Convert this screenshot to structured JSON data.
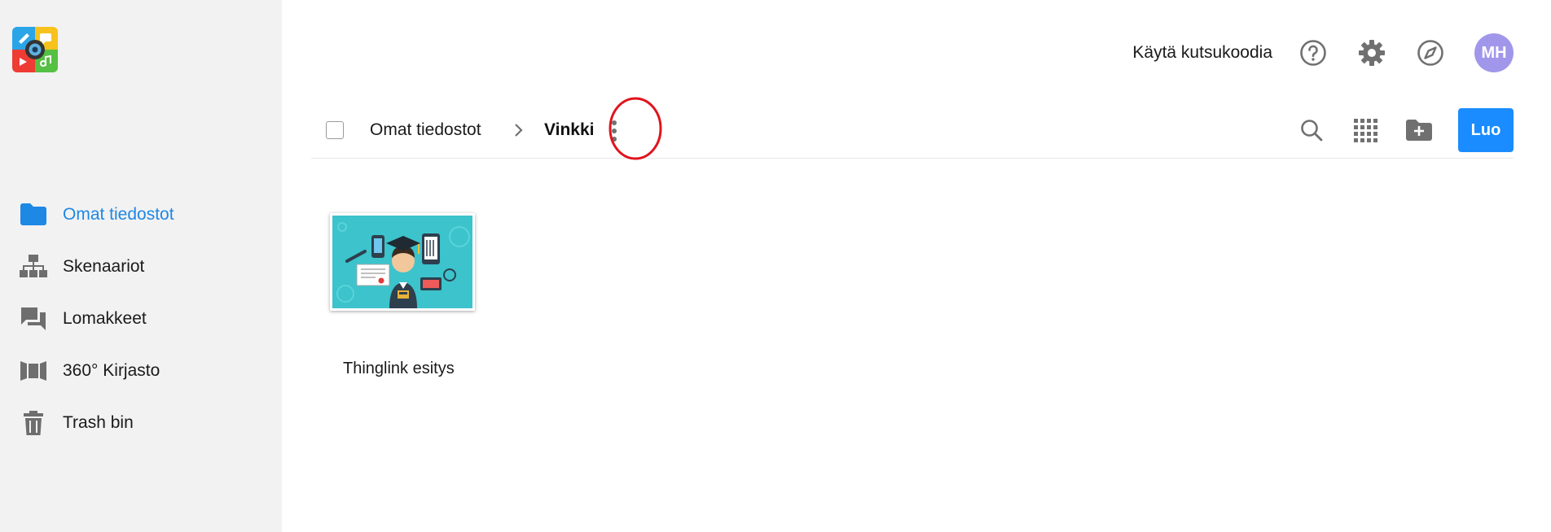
{
  "header": {
    "invite_label": "Käytä kutsukoodia",
    "avatar_initials": "MH",
    "avatar_color": "#a197ea",
    "icons": [
      "help-icon",
      "settings-gear-icon",
      "compass-icon"
    ]
  },
  "sidebar": {
    "items": [
      {
        "label": "Omat tiedostot",
        "icon": "folder-icon",
        "active": true
      },
      {
        "label": "Skenaariot",
        "icon": "sitemap-icon",
        "active": false
      },
      {
        "label": "Lomakkeet",
        "icon": "forum-icon",
        "active": false
      },
      {
        "label": "360° Kirjasto",
        "icon": "panorama-icon",
        "active": false
      },
      {
        "label": "Trash bin",
        "icon": "trash-icon",
        "active": false
      }
    ]
  },
  "breadcrumb": {
    "root": "Omat tiedostot",
    "current": "Vinkki"
  },
  "toolbar": {
    "create_label": "Luo",
    "icons": [
      "search-icon",
      "grid-view-icon",
      "new-folder-icon"
    ]
  },
  "files": [
    {
      "title": "Thinglink esitys",
      "thumbnail": "graduate-illustration"
    }
  ],
  "colors": {
    "accent": "#1a8cff",
    "active_nav": "#1e88e5",
    "sidebar_bg": "#f2f2f2",
    "annotation": "#e0141e",
    "thumb_bg": "#3cc3cc"
  }
}
